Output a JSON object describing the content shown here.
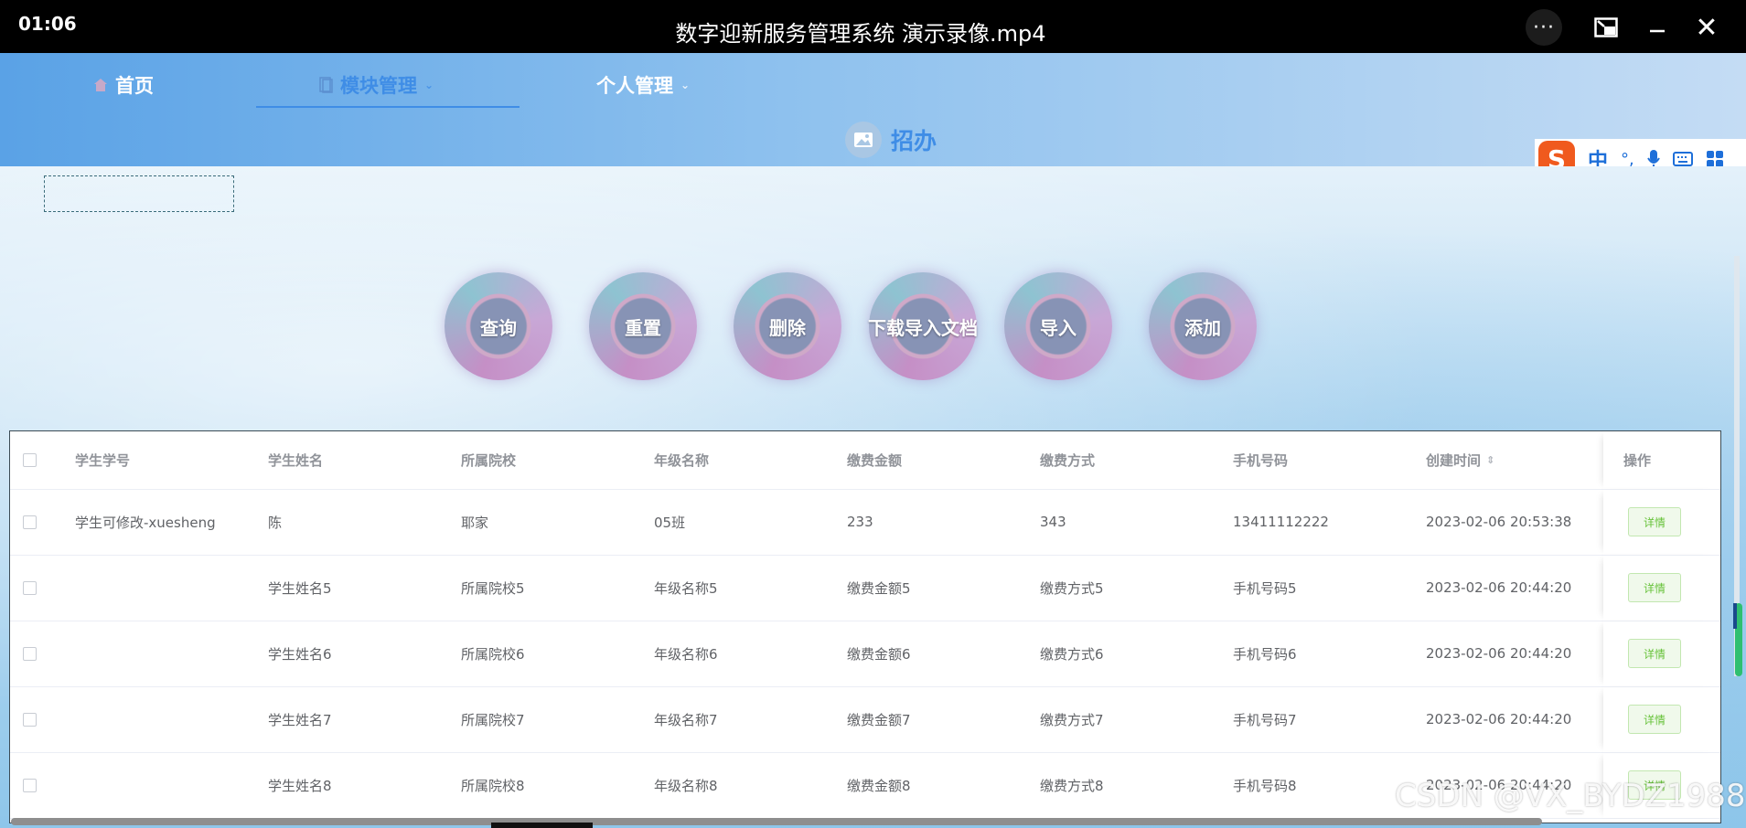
{
  "player": {
    "time": "01:06",
    "title": "数字迎新服务管理系统 演示录像.mp4",
    "more": "···",
    "close": "✕",
    "minimize": "—"
  },
  "nav": {
    "home": "首页",
    "module": "模块管理",
    "personal": "个人管理"
  },
  "brand": {
    "title": "招办"
  },
  "ime": {
    "logo": "S",
    "lang": "中",
    "punct": "°,"
  },
  "search": {
    "placeholder": ""
  },
  "actions": {
    "query": "查询",
    "reset": "重置",
    "delete": "删除",
    "download": "下载导入文档",
    "import": "导入",
    "add": "添加"
  },
  "table": {
    "headers": {
      "student_no": "学生学号",
      "student_name": "学生姓名",
      "school": "所属院校",
      "grade": "年级名称",
      "fee": "缴费金额",
      "pay_method": "缴费方式",
      "phone": "手机号码",
      "created": "创建时间",
      "op": "操作"
    },
    "detail_label": "详情",
    "rows": [
      {
        "student_no": "学生可修改-xuesheng",
        "student_name": "陈",
        "school": "耶家",
        "grade": "05班",
        "fee": "233",
        "pay_method": "343",
        "phone": "13411112222",
        "created": "2023-02-06 20:53:38"
      },
      {
        "student_no": "",
        "student_name": "学生姓名5",
        "school": "所属院校5",
        "grade": "年级名称5",
        "fee": "缴费金额5",
        "pay_method": "缴费方式5",
        "phone": "手机号码5",
        "created": "2023-02-06 20:44:20"
      },
      {
        "student_no": "",
        "student_name": "学生姓名6",
        "school": "所属院校6",
        "grade": "年级名称6",
        "fee": "缴费金额6",
        "pay_method": "缴费方式6",
        "phone": "手机号码6",
        "created": "2023-02-06 20:44:20"
      },
      {
        "student_no": "",
        "student_name": "学生姓名7",
        "school": "所属院校7",
        "grade": "年级名称7",
        "fee": "缴费金额7",
        "pay_method": "缴费方式7",
        "phone": "手机号码7",
        "created": "2023-02-06 20:44:20"
      },
      {
        "student_no": "",
        "student_name": "学生姓名8",
        "school": "所属院校8",
        "grade": "年级名称8",
        "fee": "缴费金额8",
        "pay_method": "缴费方式8",
        "phone": "手机号码8",
        "created": "2023-02-06 20:44:20"
      }
    ]
  },
  "watermark": "CSDN @VX_BYDZ1988"
}
